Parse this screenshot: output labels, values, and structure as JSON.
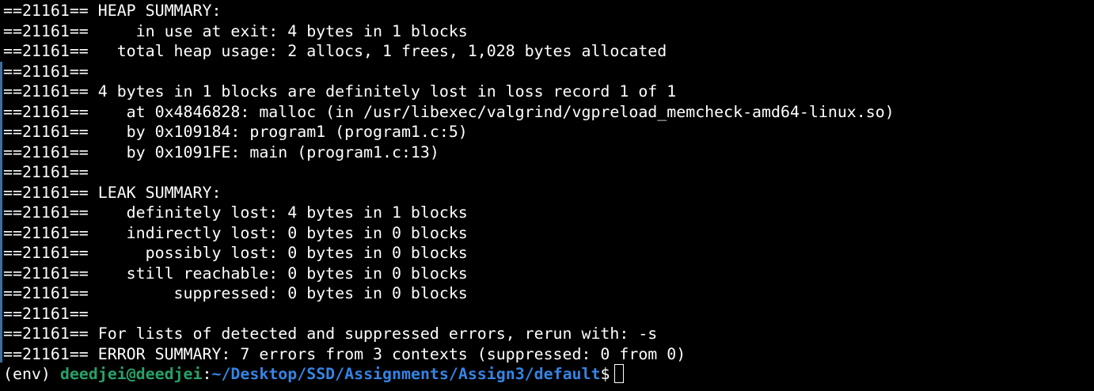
{
  "terminal": {
    "colors": {
      "background": "#000000",
      "text": "#ffffff",
      "user_host": "#26a269",
      "path": "#3584e4",
      "scroll_marker": "#3a6ea5"
    },
    "lines": [
      "==21161== HEAP SUMMARY:",
      "==21161==     in use at exit: 4 bytes in 1 blocks",
      "==21161==   total heap usage: 2 allocs, 1 frees, 1,028 bytes allocated",
      "==21161==",
      "==21161== 4 bytes in 1 blocks are definitely lost in loss record 1 of 1",
      "==21161==    at 0x4846828: malloc (in /usr/libexec/valgrind/vgpreload_memcheck-amd64-linux.so)",
      "==21161==    by 0x109184: program1 (program1.c:5)",
      "==21161==    by 0x1091FE: main (program1.c:13)",
      "==21161==",
      "==21161== LEAK SUMMARY:",
      "==21161==    definitely lost: 4 bytes in 1 blocks",
      "==21161==    indirectly lost: 0 bytes in 0 blocks",
      "==21161==      possibly lost: 0 bytes in 0 blocks",
      "==21161==    still reachable: 0 bytes in 0 blocks",
      "==21161==         suppressed: 0 bytes in 0 blocks",
      "==21161==",
      "==21161== For lists of detected and suppressed errors, rerun with: -s",
      "==21161== ERROR SUMMARY: 7 errors from 3 contexts (suppressed: 0 from 0)"
    ],
    "prompt": {
      "env": "(env) ",
      "user_host": "deedjei@deedjei",
      "separator": ":",
      "path": "~/Desktop/SSD/Assignments/Assign3/default",
      "symbol": "$"
    }
  }
}
